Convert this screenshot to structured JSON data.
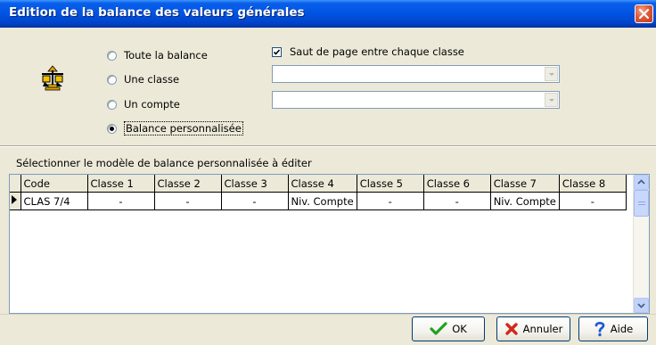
{
  "window": {
    "title": "Edition de la balance des valeurs générales",
    "close_icon": "close-icon"
  },
  "options": {
    "radios": [
      {
        "label": "Toute la balance",
        "checked": false
      },
      {
        "label": "Une classe",
        "checked": false
      },
      {
        "label": "Un compte",
        "checked": false
      },
      {
        "label": "Balance personnalisée",
        "checked": true
      }
    ],
    "page_break_label": "Saut de page entre chaque classe",
    "page_break_checked": true,
    "class_combo_value": "",
    "account_combo_value": ""
  },
  "grid": {
    "caption": "Sélectionner le modèle de balance personnalisée à éditer",
    "columns": [
      "Code",
      "Classe 1",
      "Classe 2",
      "Classe 3",
      "Classe 4",
      "Classe 5",
      "Classe 6",
      "Classe 7",
      "Classe 8"
    ],
    "rows": [
      [
        "CLAS 7/4",
        "-",
        "-",
        "-",
        "Niv. Compte",
        "-",
        "-",
        "Niv. Compte",
        "-"
      ]
    ]
  },
  "buttons": {
    "ok": "OK",
    "cancel": "Annuler",
    "help": "Aide"
  },
  "colors": {
    "titlebar": "#0054E3",
    "dialog_bg": "#ECE9D8",
    "ok_check": "#21A121",
    "cancel_x": "#D02818",
    "help_mark": "#1E5BD8"
  }
}
